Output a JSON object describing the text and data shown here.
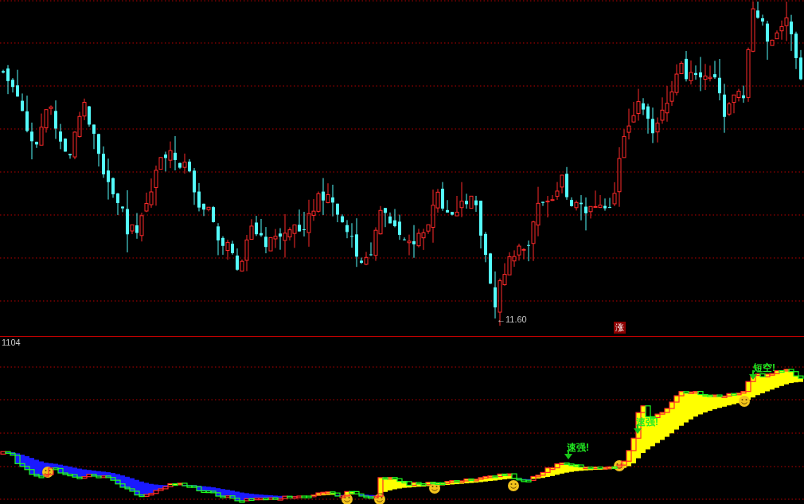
{
  "main_chart": {
    "low_price_label": "←11.60",
    "badge": "涨"
  },
  "indicator_panel": {
    "value_label": "1104",
    "signals": [
      {
        "text": "速强!"
      },
      {
        "text": "速强!"
      },
      {
        "text": "短空!"
      }
    ]
  }
}
